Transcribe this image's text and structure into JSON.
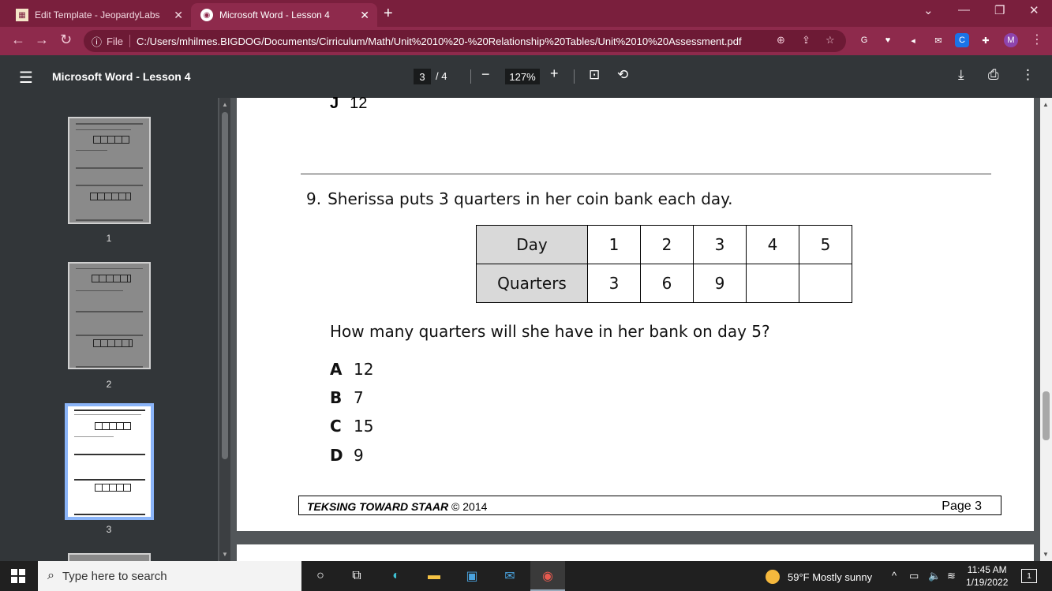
{
  "browser": {
    "tabs": [
      {
        "title": "Edit Template - JeopardyLabs",
        "active": false
      },
      {
        "title": "Microsoft Word - Lesson 4",
        "active": true
      }
    ],
    "new_tab": "+",
    "window_controls": {
      "dropdown": "⌄",
      "minimize": "—",
      "restore": "❐",
      "close": "✕"
    },
    "address": {
      "scheme_label": "File",
      "url": "C:/Users/mhilmes.BIGDOG/Documents/Cirriculum/Math/Unit%2010%20-%20Relationship%20Tables/Unit%2010%20Assessment.pdf"
    },
    "extensions": [
      {
        "name": "grammarly",
        "glyph": "G",
        "color": "#2eb67d"
      },
      {
        "name": "heart",
        "glyph": "♥",
        "color": "#e94e77"
      },
      {
        "name": "speaker",
        "glyph": "◂",
        "color": "#f29900"
      },
      {
        "name": "mail",
        "glyph": "✉",
        "color": "#8e2a4c"
      },
      {
        "name": "c-ext",
        "glyph": "C",
        "color": "#1a73e8"
      },
      {
        "name": "puzzle",
        "glyph": "✚",
        "color": "#8e2a4c"
      },
      {
        "name": "profile",
        "glyph": "M",
        "color": "#8e44ad"
      }
    ]
  },
  "pdf": {
    "title": "Microsoft Word - Lesson 4",
    "current_page": "3",
    "total_pages": "/ 4",
    "zoom": "127%",
    "thumbnails": [
      "1",
      "2",
      "3"
    ]
  },
  "document": {
    "previous_answer": {
      "letter": "J",
      "text": "12"
    },
    "question": {
      "number": "9.",
      "text": "Sherissa puts 3 quarters in her coin bank each day.",
      "table": {
        "row1_header": "Day",
        "row1": [
          "1",
          "2",
          "3",
          "4",
          "5"
        ],
        "row2_header": "Quarters",
        "row2": [
          "3",
          "6",
          "9",
          "",
          ""
        ]
      },
      "prompt": "How many quarters will she have in her bank on day 5?",
      "choices": [
        {
          "letter": "A",
          "text": "12"
        },
        {
          "letter": "B",
          "text": "7"
        },
        {
          "letter": "C",
          "text": "15"
        },
        {
          "letter": "D",
          "text": "9"
        }
      ]
    },
    "footer": {
      "left": "TEKSING TOWARD STAAR",
      "copyright": "© 2014",
      "right": "Page 3"
    }
  },
  "taskbar": {
    "search_placeholder": "Type here to search",
    "weather": "59°F  Mostly sunny",
    "time": "11:45 AM",
    "date": "1/19/2022",
    "notification_count": "1"
  }
}
